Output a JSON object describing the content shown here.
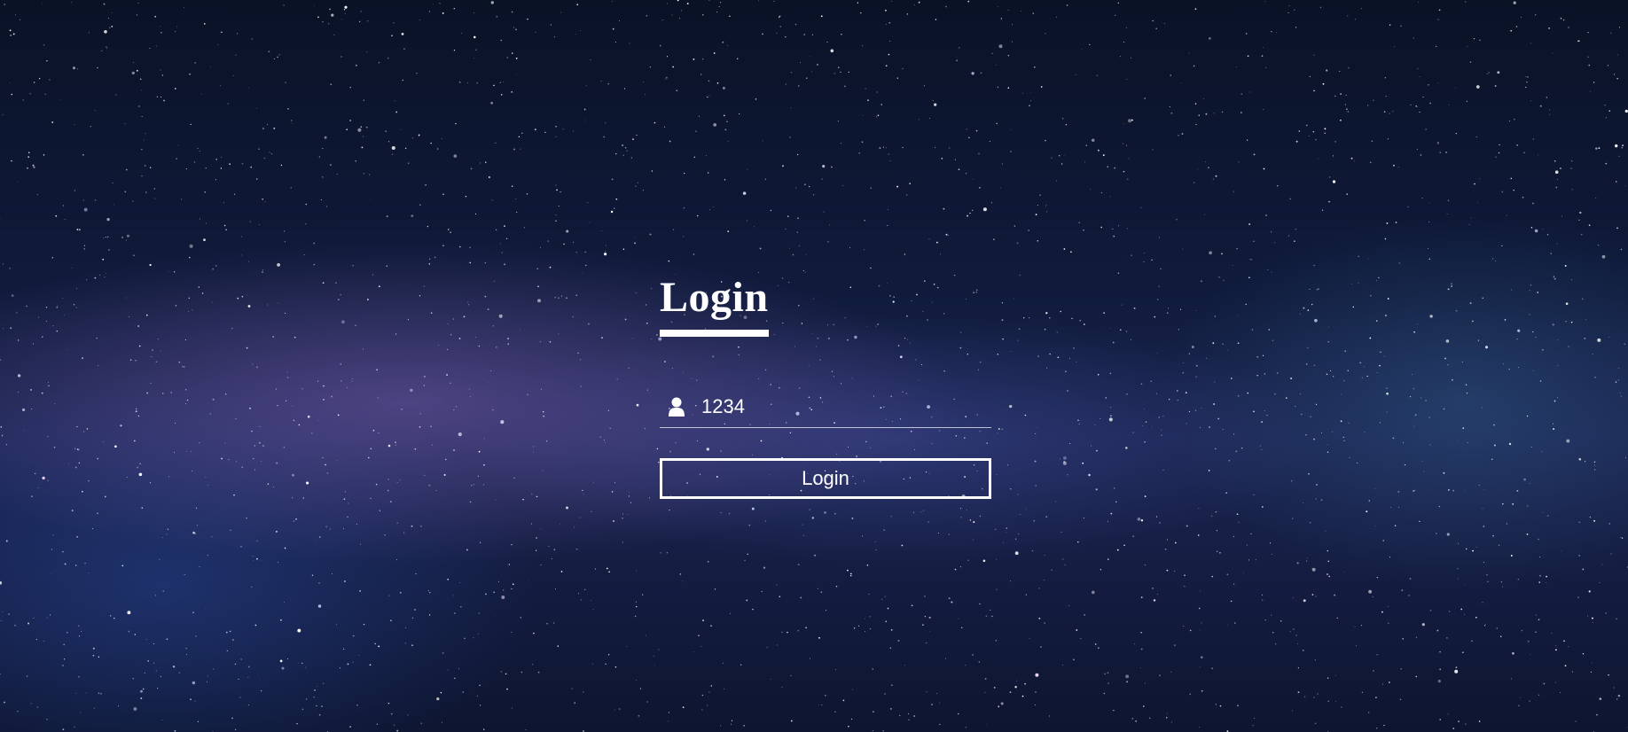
{
  "login": {
    "title": "Login",
    "username": {
      "value": "1234",
      "icon": "user-icon"
    },
    "submit_label": "Login"
  },
  "colors": {
    "text": "#ffffff",
    "background": "#101b3c"
  }
}
